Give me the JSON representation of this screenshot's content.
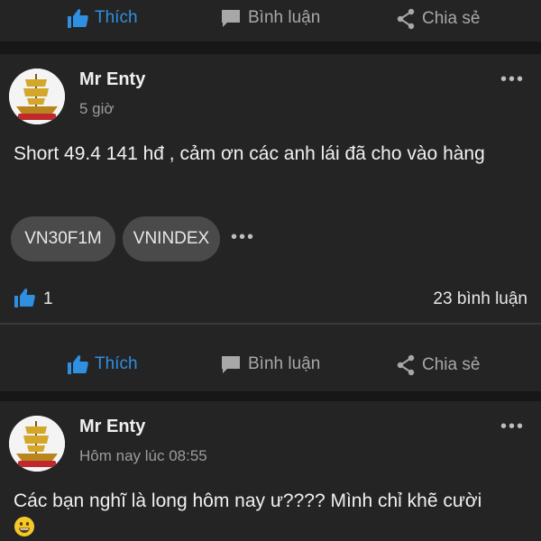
{
  "actions": {
    "like": "Thích",
    "comment": "Bình luận",
    "share": "Chia sẻ"
  },
  "posts": [
    {
      "author": "Mr Enty",
      "time": "5 giờ",
      "content": "Short 49.4  141 hđ , cảm ơn các anh lái đã cho vào hàng",
      "tags": [
        "VN30F1M",
        "VNINDEX"
      ],
      "likes": "1",
      "comments": "23 bình luận"
    },
    {
      "author": "Mr Enty",
      "time": "Hôm nay lúc 08:55",
      "content": "Các bạn nghĩ là long hôm nay ư???? Mình chỉ khẽ cười"
    }
  ],
  "colors": {
    "accent": "#2f8fe0",
    "card": "#242424",
    "background": "#171717"
  }
}
